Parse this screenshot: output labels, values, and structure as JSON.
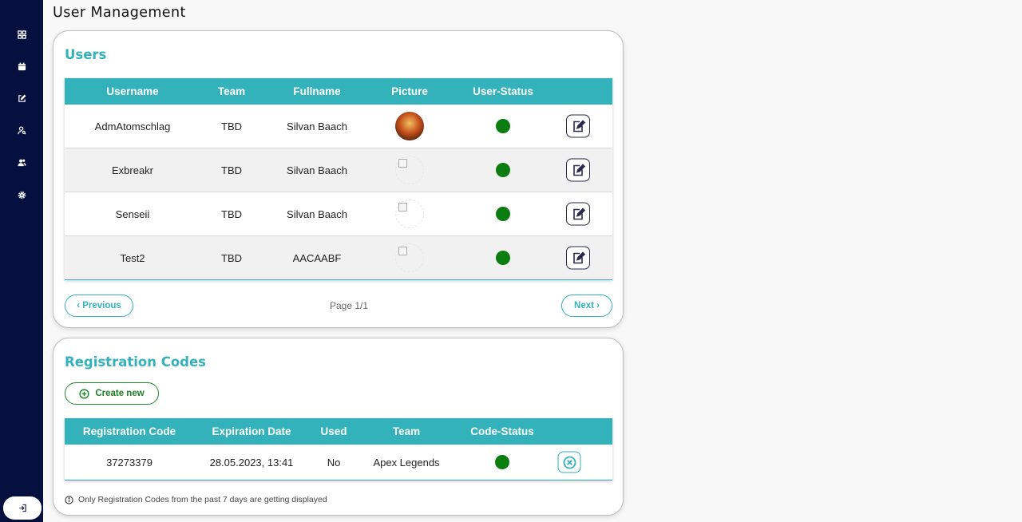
{
  "page": {
    "title": "User Management"
  },
  "sidebar": {
    "items": [
      {
        "icon": "grid-icon"
      },
      {
        "icon": "calendar-icon"
      },
      {
        "icon": "edit-square-icon"
      },
      {
        "icon": "user-search-icon"
      },
      {
        "icon": "users-icon"
      },
      {
        "icon": "settings-gear-icon"
      }
    ],
    "logout_icon": "logout-icon"
  },
  "users": {
    "heading": "Users",
    "columns": [
      "Username",
      "Team",
      "Fullname",
      "Picture",
      "User-Status"
    ],
    "rows": [
      {
        "username": "AdmAtomschlag",
        "team": "TBD",
        "fullname": "Silvan Baach",
        "picture": "avatar",
        "status": "active"
      },
      {
        "username": "Exbreakr",
        "team": "TBD",
        "fullname": "Silvan Baach",
        "picture": "broken",
        "status": "active"
      },
      {
        "username": "Senseii",
        "team": "TBD",
        "fullname": "Silvan Baach",
        "picture": "broken",
        "status": "active"
      },
      {
        "username": "Test2",
        "team": "TBD",
        "fullname": "AACAABF",
        "picture": "broken",
        "status": "active"
      }
    ],
    "pagination": {
      "previous": "‹ Previous",
      "info": "Page 1/1",
      "next": "Next ›"
    }
  },
  "codes": {
    "heading": "Registration Codes",
    "create_label": "Create new",
    "columns": [
      "Registration Code",
      "Expiration Date",
      "Used",
      "Team",
      "Code-Status"
    ],
    "rows": [
      {
        "code": "37273379",
        "expiration": "28.05.2023, 13:41",
        "used": "No",
        "team": "Apex Legends",
        "status": "active"
      }
    ],
    "note": "Only Registration Codes from the past 7 days are getting displayed"
  },
  "colors": {
    "sidebar": "#06103f",
    "accent": "#33b2bb",
    "status_active": "#0b7c10",
    "create": "#1f8a2a"
  }
}
